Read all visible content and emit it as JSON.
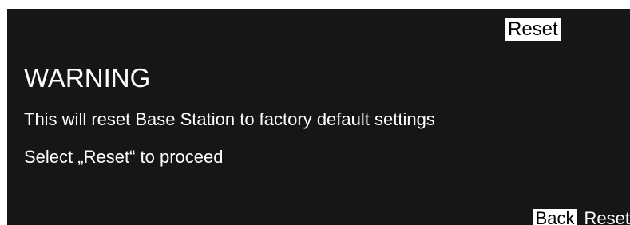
{
  "header": {
    "title": "Reset"
  },
  "dialog": {
    "heading": "WARNING",
    "message": "This will reset Base Station to factory default settings",
    "instruction": "Select „Reset“ to proceed"
  },
  "softkeys": {
    "back_label": "Back",
    "reset_label": "Reset"
  },
  "colors": {
    "screen_background": "#161616",
    "text": "#ffffff",
    "highlight_background": "#ffffff",
    "highlight_text": "#000000"
  }
}
